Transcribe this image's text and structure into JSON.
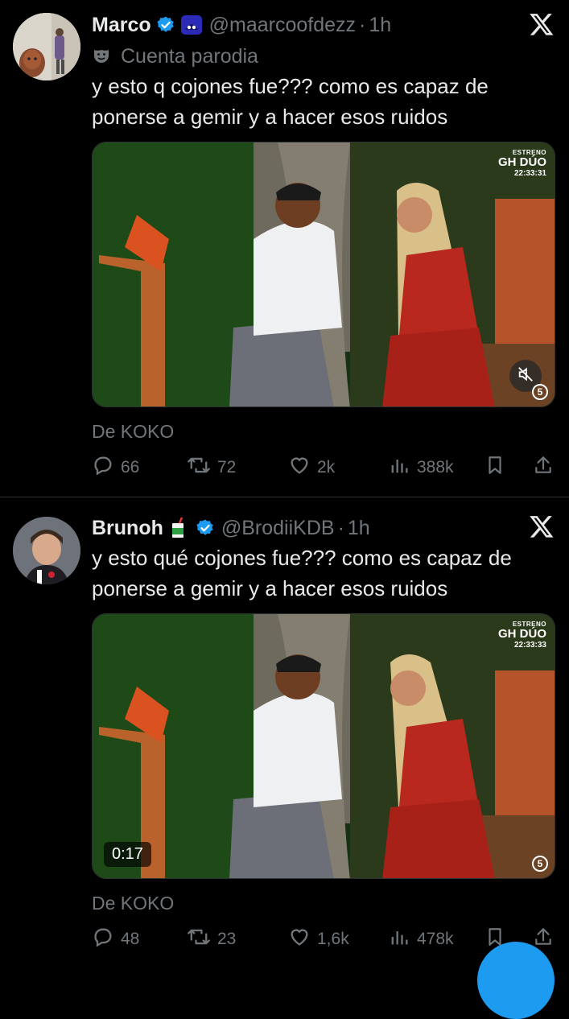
{
  "tweets": [
    {
      "display_name": "Marco",
      "handle": "@maarcoofdezz",
      "dot": "·",
      "time": "1h",
      "parody_label": "Cuenta parodia",
      "text": "y esto q cojones fue??? como es capaz de ponerse a gemir y a hacer esos ruidos",
      "media": {
        "badge_top": "ESTRENO",
        "badge_title": "GH DÚO",
        "badge_time": "22:33:31",
        "channel": "5"
      },
      "from": "De KOKO",
      "stats": {
        "replies": "66",
        "reposts": "72",
        "likes": "2k",
        "views": "388k"
      }
    },
    {
      "display_name": "Brunoh",
      "handle": "@BrodiiKDB",
      "dot": "·",
      "time": "1h",
      "text": "y esto qué cojones fue??? como es capaz de ponerse a gemir y a hacer esos ruidos",
      "media": {
        "badge_top": "ESTRENO",
        "badge_title": "GH DÚO",
        "badge_time": "22:33:33",
        "duration": "0:17",
        "channel": "5"
      },
      "from": "De KOKO",
      "stats": {
        "replies": "48",
        "reposts": "23",
        "likes": "1,6k",
        "views": "478k"
      }
    }
  ],
  "colors": {
    "background": "#000000",
    "text": "#e7e9ea",
    "muted": "#71767b",
    "verified": "#1d9bf0",
    "divider": "#2f3336"
  }
}
